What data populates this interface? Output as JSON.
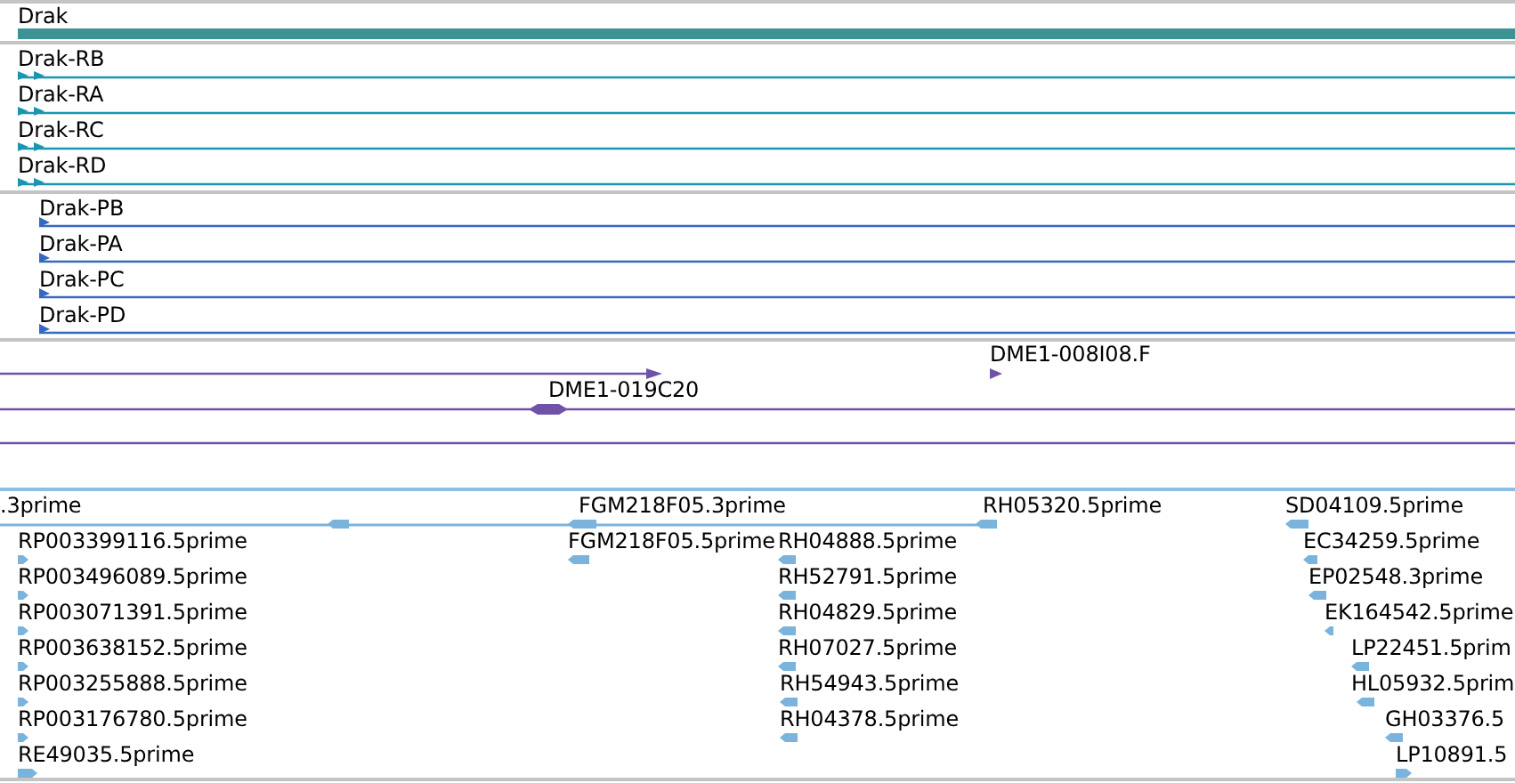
{
  "gene": {
    "label": "Drak"
  },
  "transcripts": [
    {
      "label": "Drak-RB"
    },
    {
      "label": "Drak-RA"
    },
    {
      "label": "Drak-RC"
    },
    {
      "label": "Drak-RD"
    }
  ],
  "proteins": [
    {
      "label": "Drak-PB"
    },
    {
      "label": "Drak-PA"
    },
    {
      "label": "Drak-PC"
    },
    {
      "label": "Drak-PD"
    }
  ],
  "clones": [
    {
      "label": "DME1-008I08.F"
    },
    {
      "label": "DME1-019C20"
    }
  ],
  "ests": [
    {
      "label": ".3prime",
      "kind": "reverse"
    },
    {
      "label": "FGM218F05.3prime",
      "kind": "reverse"
    },
    {
      "label": "RH05320.5prime",
      "kind": "reverse"
    },
    {
      "label": "SD04109.5prime",
      "kind": "reverse"
    },
    {
      "label": "RP003399116.5prime",
      "kind": "forward"
    },
    {
      "label": "FGM218F05.5prime",
      "kind": "reverse"
    },
    {
      "label": "RH04888.5prime",
      "kind": "reverse"
    },
    {
      "label": "EC34259.5prime",
      "kind": "reverse"
    },
    {
      "label": "RP003496089.5prime",
      "kind": "forward"
    },
    {
      "label": "RH52791.5prime",
      "kind": "reverse"
    },
    {
      "label": "EP02548.3prime",
      "kind": "reverse"
    },
    {
      "label": "RP003071391.5prime",
      "kind": "forward"
    },
    {
      "label": "RH04829.5prime",
      "kind": "reverse"
    },
    {
      "label": "EK164542.5prime",
      "kind": "reverse"
    },
    {
      "label": "RP003638152.5prime",
      "kind": "forward"
    },
    {
      "label": "RH07027.5prime",
      "kind": "reverse"
    },
    {
      "label": "LP22451.5prim",
      "kind": "reverse"
    },
    {
      "label": "RP003255888.5prime",
      "kind": "forward"
    },
    {
      "label": "RH54943.5prime",
      "kind": "reverse"
    },
    {
      "label": "HL05932.5prim",
      "kind": "reverse"
    },
    {
      "label": "RP003176780.5prime",
      "kind": "forward"
    },
    {
      "label": "RH04378.5prime",
      "kind": "reverse"
    },
    {
      "label": "GH03376.5",
      "kind": "reverse"
    },
    {
      "label": "RE49035.5prime",
      "kind": "forward"
    },
    {
      "label": "LP10891.5",
      "kind": "forward"
    }
  ]
}
